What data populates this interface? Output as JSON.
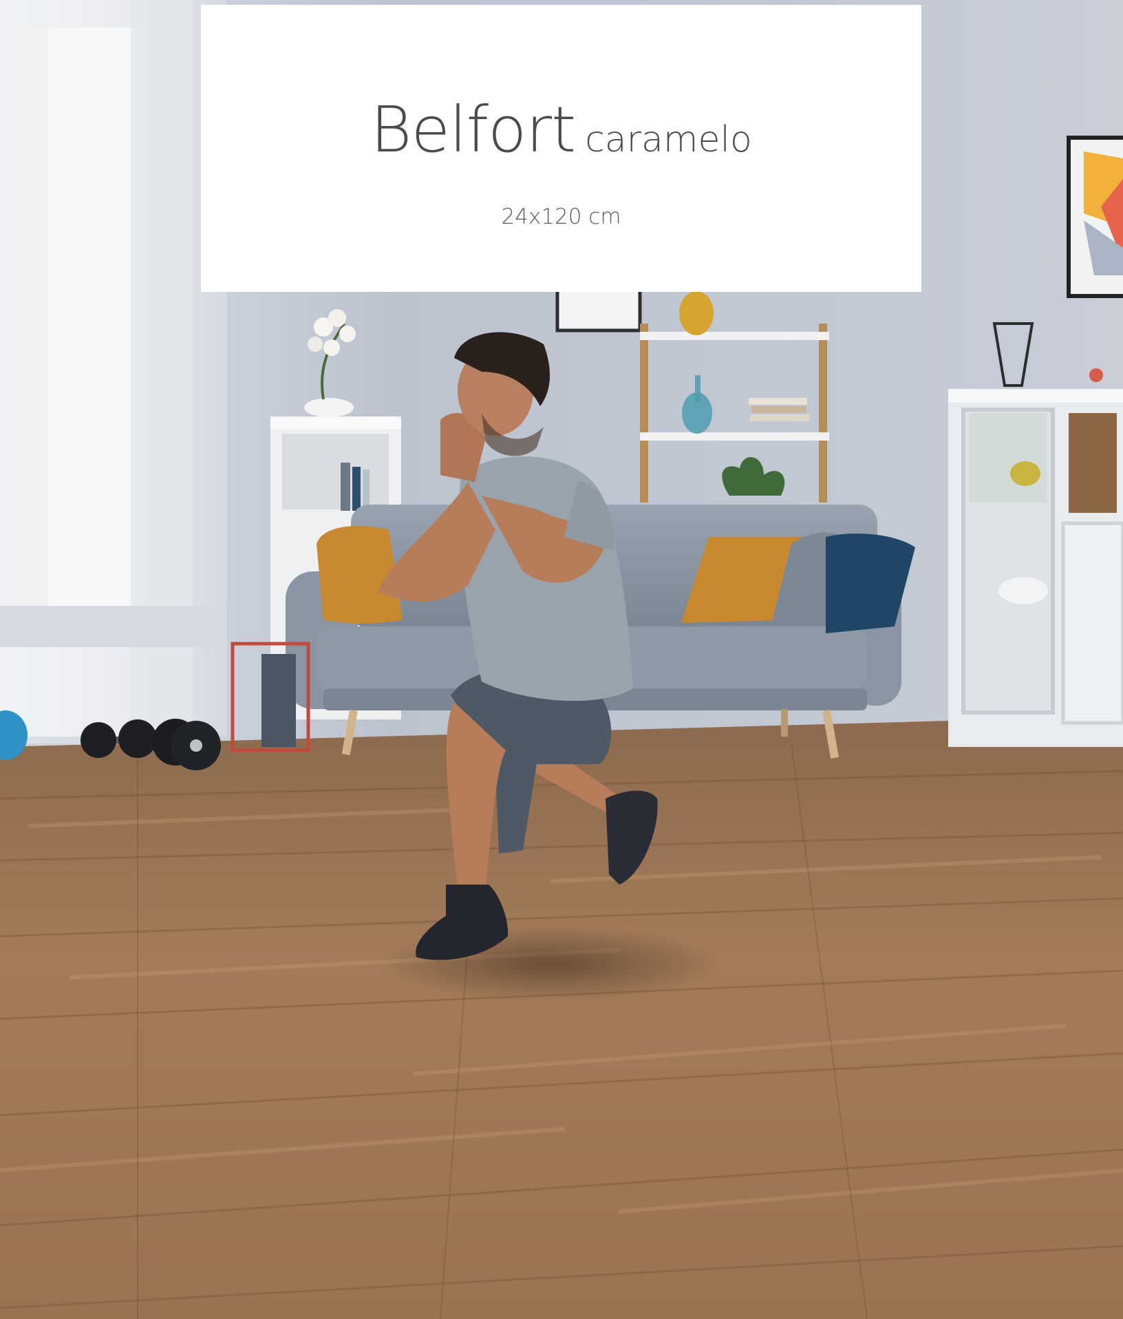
{
  "product": {
    "name": "Belfort",
    "variant": "caramelo",
    "size": "24x120 cm"
  },
  "scene": {
    "description_icons": [
      "sofa-icon",
      "window-icon",
      "dumbbell-icon",
      "shelf-icon",
      "cabinet-icon",
      "person-icon"
    ],
    "colors": {
      "wall": "#c9ced8",
      "floor": "#9c7655",
      "sofa": "#8e98a6",
      "pillow_mustard": "#c8892e",
      "pillow_navy": "#1f4666",
      "shirt": "#98a3ac",
      "shorts": "#4f5966",
      "skin": "#b77c5a"
    }
  }
}
